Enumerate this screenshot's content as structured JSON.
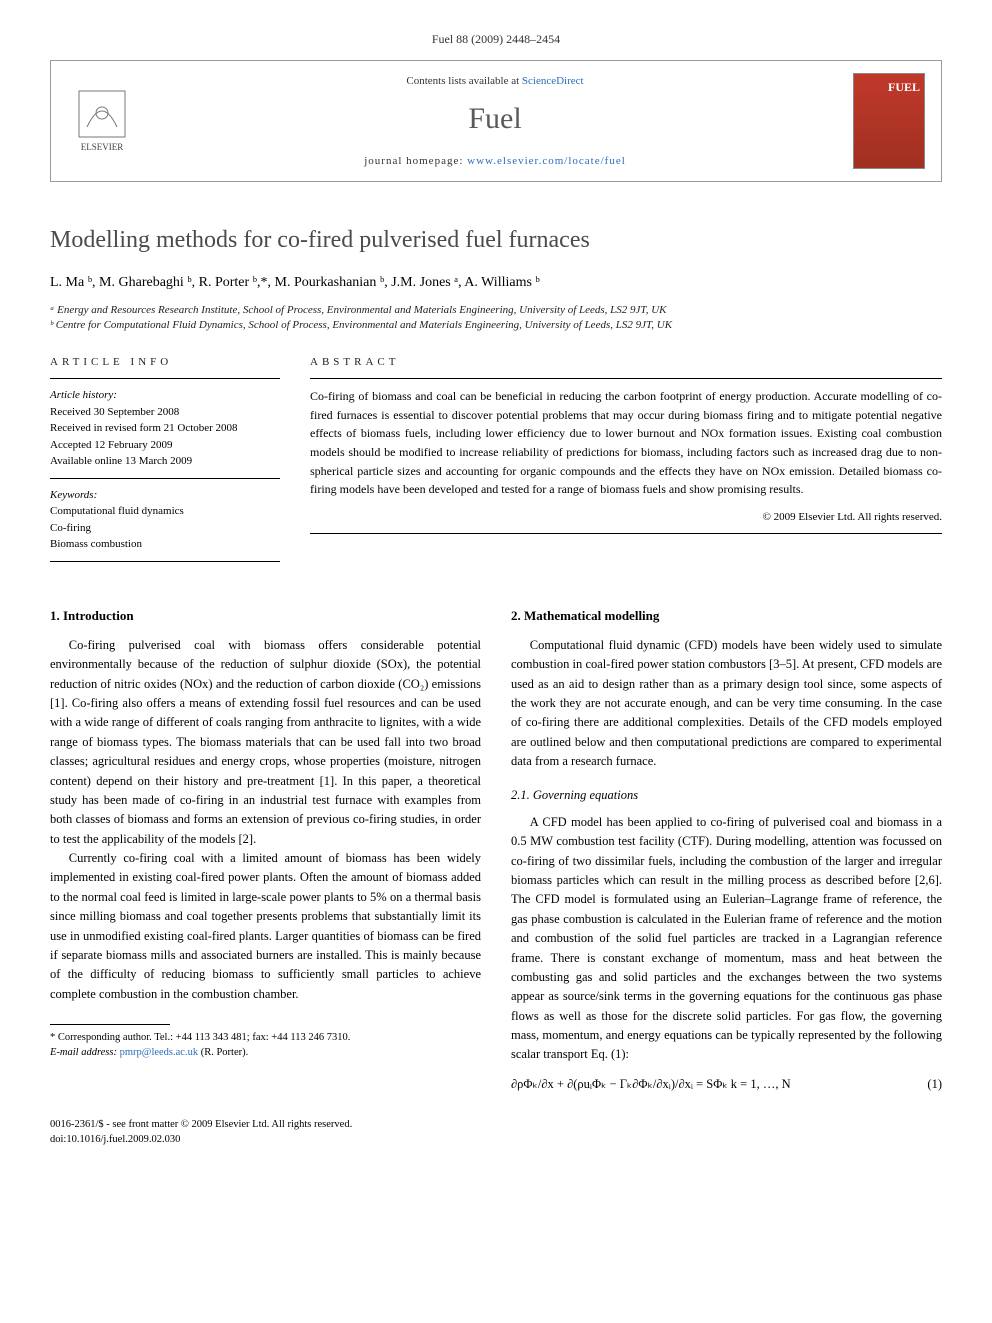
{
  "journal_ref": "Fuel 88 (2009) 2448–2454",
  "header": {
    "contents_prefix": "Contents lists available at ",
    "contents_link": "ScienceDirect",
    "journal_name": "Fuel",
    "homepage_prefix": "journal homepage: ",
    "homepage_url": "www.elsevier.com/locate/fuel",
    "elsevier_label": "ELSEVIER",
    "cover_label": "FUEL"
  },
  "title": "Modelling methods for co-fired pulverised fuel furnaces",
  "authors_html": "L. Ma ᵇ, M. Gharebaghi ᵇ, R. Porter ᵇ,*, M. Pourkashanian ᵇ, J.M. Jones ᵃ, A. Williams ᵇ",
  "affiliations": {
    "a": "ᵃ Energy and Resources Research Institute, School of Process, Environmental and Materials Engineering, University of Leeds, LS2 9JT, UK",
    "b": "ᵇ Centre for Computational Fluid Dynamics, School of Process, Environmental and Materials Engineering, University of Leeds, LS2 9JT, UK"
  },
  "article_info": {
    "header": "ARTICLE INFO",
    "history_label": "Article history:",
    "received": "Received 30 September 2008",
    "revised": "Received in revised form 21 October 2008",
    "accepted": "Accepted 12 February 2009",
    "online": "Available online 13 March 2009",
    "keywords_label": "Keywords:",
    "keywords": [
      "Computational fluid dynamics",
      "Co-firing",
      "Biomass combustion"
    ]
  },
  "abstract": {
    "header": "ABSTRACT",
    "text": "Co-firing of biomass and coal can be beneficial in reducing the carbon footprint of energy production. Accurate modelling of co-fired furnaces is essential to discover potential problems that may occur during biomass firing and to mitigate potential negative effects of biomass fuels, including lower efficiency due to lower burnout and NOx formation issues. Existing coal combustion models should be modified to increase reliability of predictions for biomass, including factors such as increased drag due to non-spherical particle sizes and accounting for organic compounds and the effects they have on NOx emission. Detailed biomass co-firing models have been developed and tested for a range of biomass fuels and show promising results.",
    "copyright": "© 2009 Elsevier Ltd. All rights reserved."
  },
  "sections": {
    "s1": {
      "heading": "1. Introduction",
      "p1": "Co-firing pulverised coal with biomass offers considerable potential environmentally because of the reduction of sulphur dioxide (SOx), the potential reduction of nitric oxides (NOx) and the reduction of carbon dioxide (CO₂) emissions [1]. Co-firing also offers a means of extending fossil fuel resources and can be used with a wide range of different of coals ranging from anthracite to lignites, with a wide range of biomass types. The biomass materials that can be used fall into two broad classes; agricultural residues and energy crops, whose properties (moisture, nitrogen content) depend on their history and pre-treatment [1]. In this paper, a theoretical study has been made of co-firing in an industrial test furnace with examples from both classes of biomass and forms an extension of previous co-firing studies, in order to test the applicability of the models [2].",
      "p2": "Currently co-firing coal with a limited amount of biomass has been widely implemented in existing coal-fired power plants. Often the amount of biomass added to the normal coal feed is limited in large-scale power plants to 5% on a thermal basis since milling biomass and coal together presents problems that substantially limit its use in unmodified existing coal-fired plants. Larger quantities of biomass can be fired if separate biomass mills and associated burners are installed. This is mainly because of the difficulty of reducing biomass to sufficiently small particles to achieve complete combustion in the combustion chamber."
    },
    "s2": {
      "heading": "2. Mathematical modelling",
      "p1": "Computational fluid dynamic (CFD) models have been widely used to simulate combustion in coal-fired power station combustors [3–5]. At present, CFD models are used as an aid to design rather than as a primary design tool since, some aspects of the work they are not accurate enough, and can be very time consuming. In the case of co-firing there are additional complexities. Details of the CFD models employed are outlined below and then computational predictions are compared to experimental data from a research furnace."
    },
    "s21": {
      "heading": "2.1. Governing equations",
      "p1": "A CFD model has been applied to co-firing of pulverised coal and biomass in a 0.5 MW combustion test facility (CTF). During modelling, attention was focussed on co-firing of two dissimilar fuels, including the combustion of the larger and irregular biomass particles which can result in the milling process as described before [2,6]. The CFD model is formulated using an Eulerian–Lagrange frame of reference, the gas phase combustion is calculated in the Eulerian frame of reference and the motion and combustion of the solid fuel particles are tracked in a Lagrangian reference frame. There is constant exchange of momentum, mass and heat between the combusting gas and solid particles and the exchanges between the two systems appear as source/sink terms in the governing equations for the continuous gas phase flows as well as those for the discrete solid particles. For gas flow, the governing mass, momentum, and energy equations can be typically represented by the following scalar transport Eq. (1):"
    }
  },
  "equation": {
    "expr": "∂ρΦₖ/∂x + ∂(ρuᵢΦₖ − Γₖ∂Φₖ/∂xᵢ)/∂xᵢ = SΦₖ   k = 1, …, N",
    "num": "(1)"
  },
  "footnotes": {
    "corr": "* Corresponding author. Tel.: +44 113 343 481; fax: +44 113 246 7310.",
    "email_label": "E-mail address: ",
    "email": "pmrp@leeds.ac.uk",
    "email_author": " (R. Porter)."
  },
  "footer": {
    "line1": "0016-2361/$ - see front matter © 2009 Elsevier Ltd. All rights reserved.",
    "line2": "doi:10.1016/j.fuel.2009.02.030"
  }
}
